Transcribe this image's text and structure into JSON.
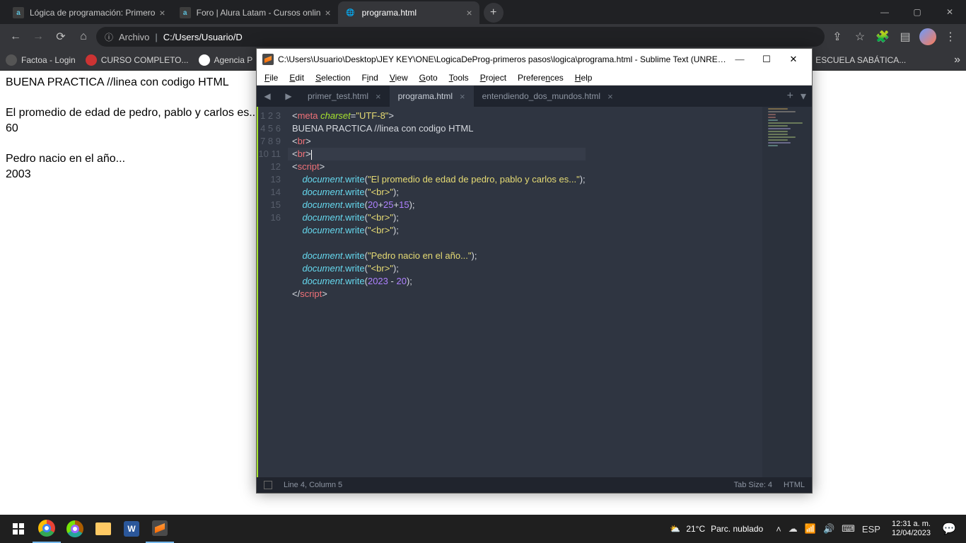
{
  "chrome": {
    "tabs": [
      {
        "label": "Lógica de programación: Primero",
        "favicon": "a"
      },
      {
        "label": "Foro | Alura Latam - Cursos onlin",
        "favicon": "a"
      },
      {
        "label": "programa.html",
        "favicon": "globe",
        "active": true
      }
    ],
    "omnibox_prefix": "Archivo",
    "omnibox_path": "C:/Users/Usuario/D",
    "bookmarks": [
      "Factoa - Login",
      "CURSO COMPLETO...",
      "Agencia P",
      "ESCUELA SABÁTICA..."
    ]
  },
  "page": {
    "line1": "BUENA PRACTICA //linea con codigo HTML",
    "line2": "El promedio de edad de pedro, pablo y carlos es...",
    "line3": "60",
    "line4": "Pedro nacio en el año...",
    "line5": "2003"
  },
  "sublime": {
    "title": "C:\\Users\\Usuario\\Desktop\\JEY KEY\\ONE\\LogicaDeProg-primeros pasos\\logica\\programa.html - Sublime Text (UNREGI...",
    "menu": [
      "File",
      "Edit",
      "Selection",
      "Find",
      "View",
      "Goto",
      "Tools",
      "Project",
      "Preferences",
      "Help"
    ],
    "tabs": [
      {
        "label": "primer_test.html"
      },
      {
        "label": "programa.html",
        "active": true
      },
      {
        "label": "entendiendo_dos_mundos.html"
      }
    ],
    "status_left": "Line 4, Column 5",
    "status_tab": "Tab Size: 4",
    "status_lang": "HTML",
    "code_raw": "<meta charset=\"UTF-8\">\nBUENA PRACTICA //linea con codigo HTML\n<br>\n<br>\n<script>\n    document.write(\"El promedio de edad de pedro, pablo y carlos es...\");\n    document.write(\"<br>\");\n    document.write(20+25+15);\n    document.write(\"<br>\");\n    document.write(\"<br>\");\n\n    document.write(\"Pedro nacio en el año...\");\n    document.write(\"<br>\");\n    document.write(2023 - 20);\n</script>\n"
  },
  "taskbar": {
    "weather_temp": "21°C",
    "weather_desc": "Parc. nublado",
    "lang": "ESP",
    "time": "12:31 a. m.",
    "date": "12/04/2023"
  }
}
